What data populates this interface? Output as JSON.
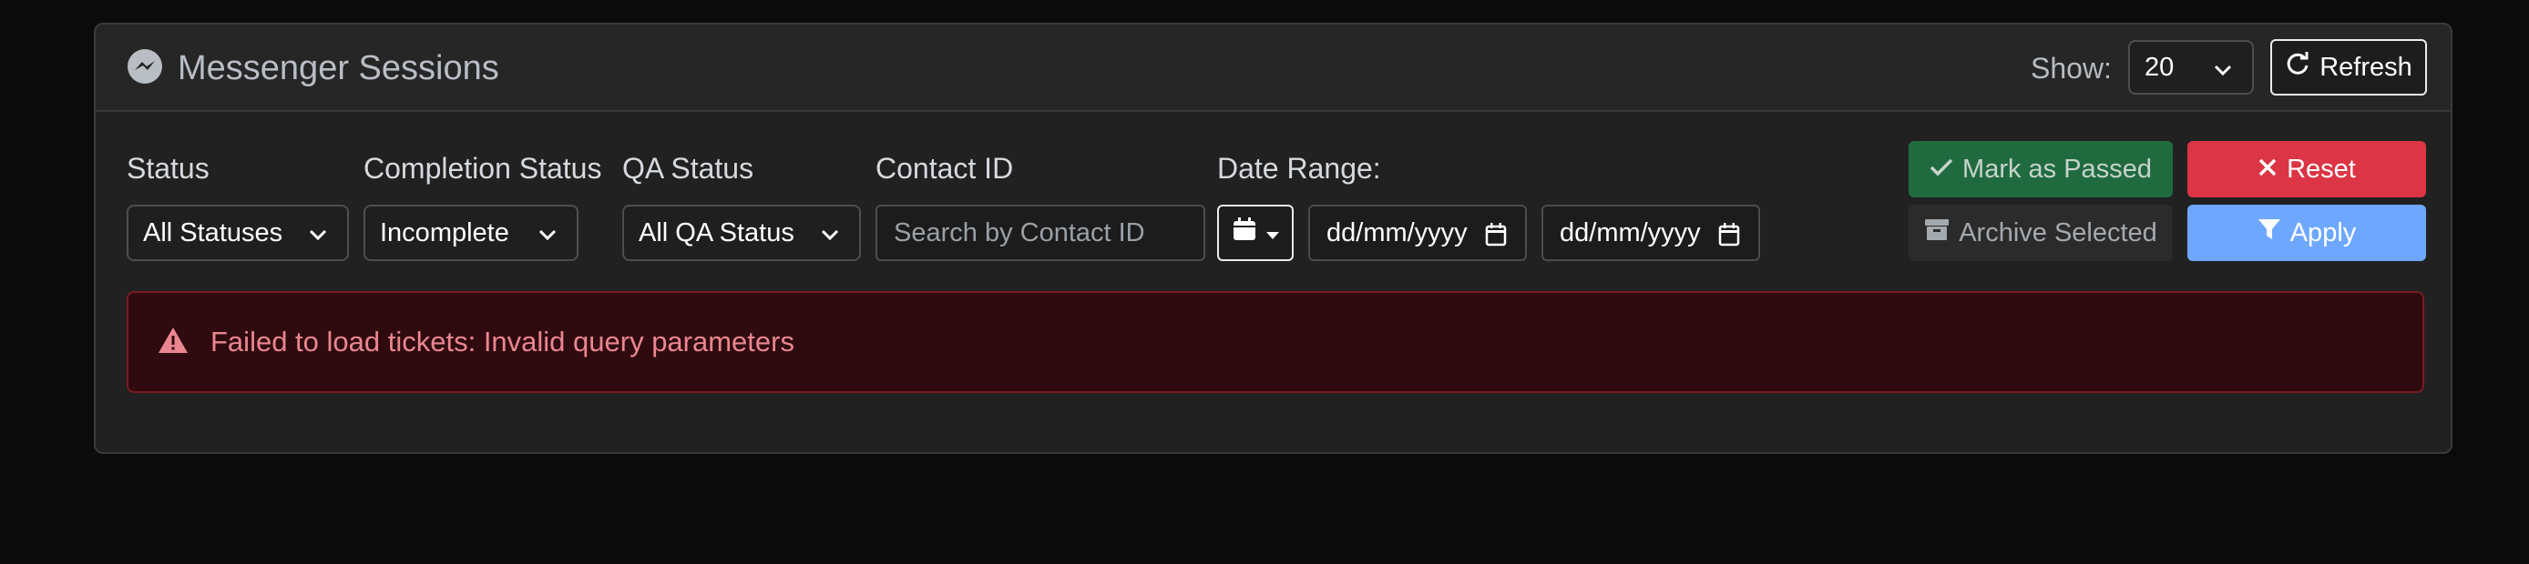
{
  "header": {
    "title": "Messenger Sessions",
    "show_label": "Show:",
    "page_size": "20",
    "refresh_label": "Refresh"
  },
  "filters": {
    "status": {
      "label": "Status",
      "value": "All Statuses"
    },
    "completion": {
      "label": "Completion Status",
      "value": "Incomplete"
    },
    "qa": {
      "label": "QA Status",
      "value": "All QA Status"
    },
    "contact": {
      "label": "Contact ID",
      "placeholder": "Search by Contact ID"
    },
    "date": {
      "label": "Date Range:",
      "from": "dd/mm/yyyy",
      "to": "dd/mm/yyyy"
    }
  },
  "actions": {
    "mark_passed": "Mark as Passed",
    "reset": "Reset",
    "archive": "Archive Selected",
    "apply": "Apply"
  },
  "alert": {
    "message": "Failed to load tickets: Invalid query parameters"
  },
  "colors": {
    "success": "#1f6b3f",
    "danger": "#dc3545",
    "primary": "#6ea8fe",
    "alert_bg": "#2f0b10",
    "alert_text": "#ea868f"
  },
  "icons": {
    "title": "messenger-icon",
    "refresh": "sync-icon",
    "date_picker": "calendar-icon",
    "mark_passed": "check-icon",
    "reset": "x-icon",
    "archive": "archive-box-icon",
    "apply": "funnel-icon",
    "alert": "warning-triangle-icon"
  }
}
